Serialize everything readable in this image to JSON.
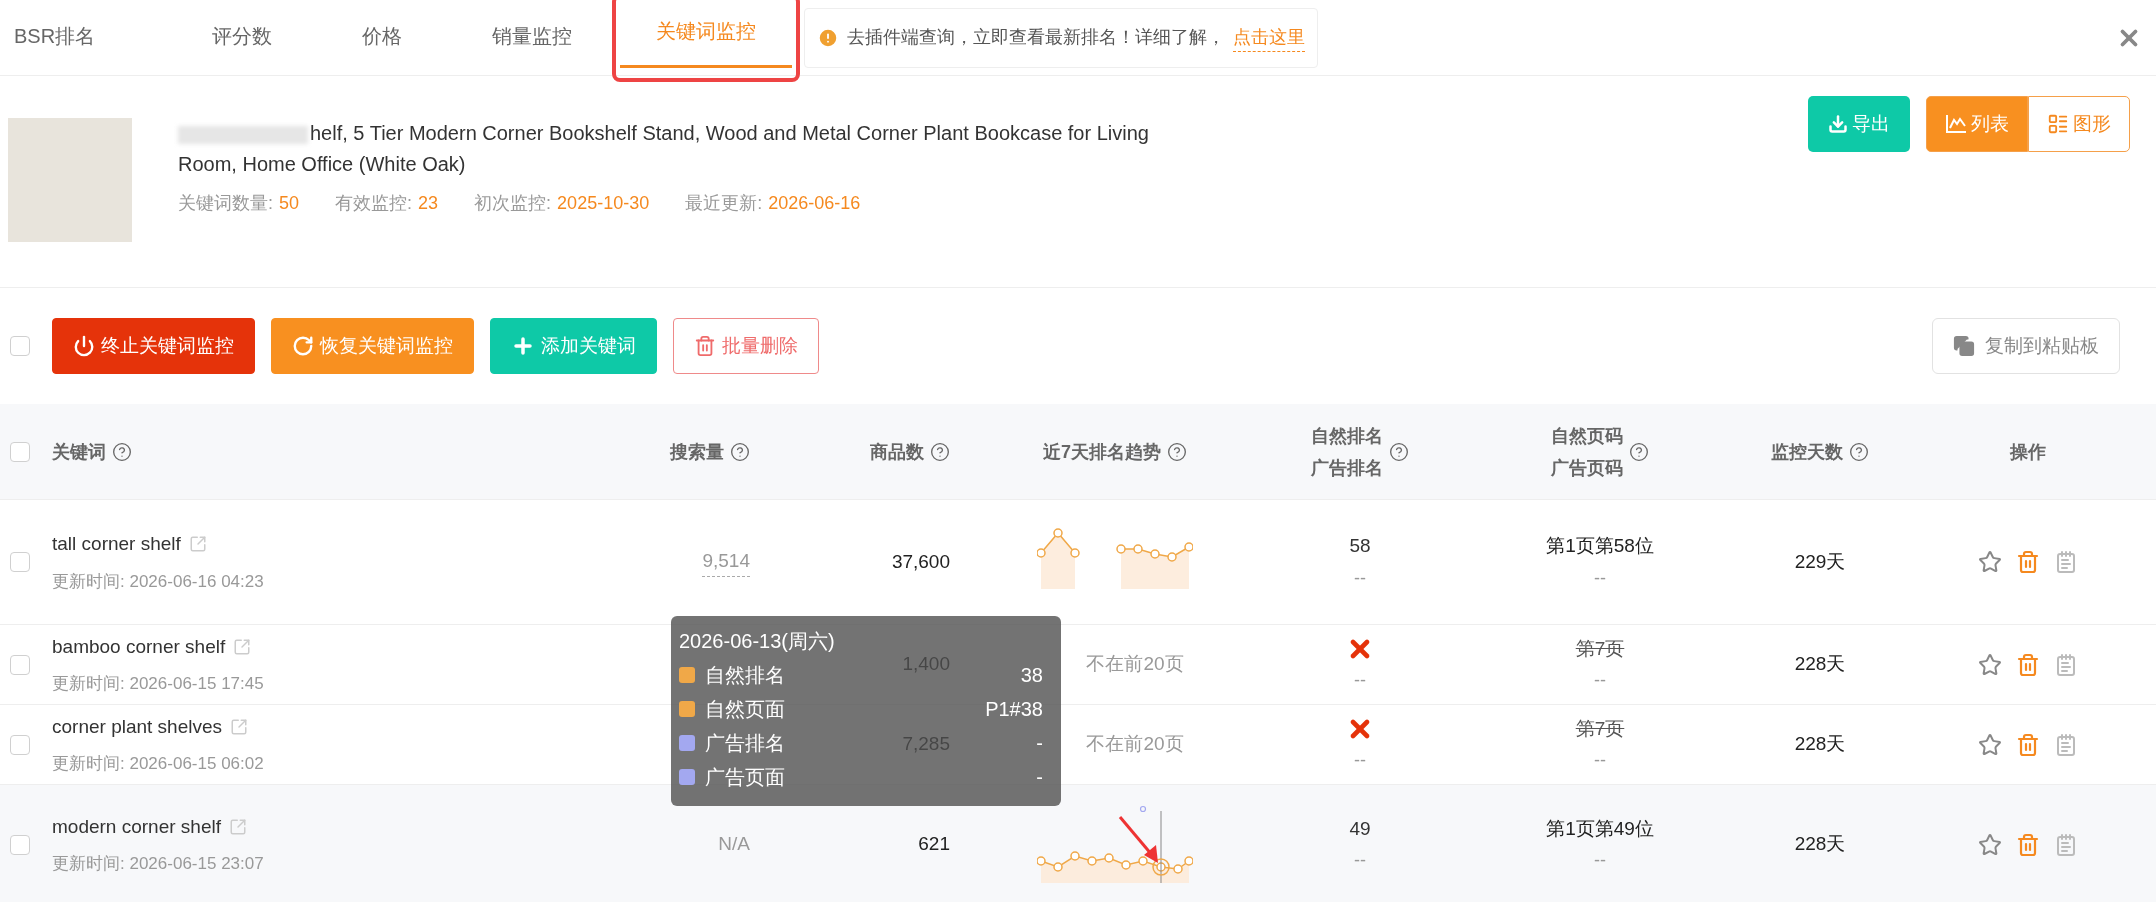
{
  "tabs": [
    {
      "label": "BSR排名",
      "selected": false
    },
    {
      "label": "评分数",
      "selected": false
    },
    {
      "label": "价格",
      "selected": false
    },
    {
      "label": "销量监控",
      "selected": false
    },
    {
      "label": "关键词监控",
      "selected": true
    }
  ],
  "notice": {
    "text": "去插件端查询，立即查看最新排名！详细了解，",
    "link": "点击这里"
  },
  "product": {
    "title": "helf, 5 Tier Modern Corner Bookshelf Stand, Wood and Metal Corner Plant Bookcase for Living Room, Home Office (White Oak)",
    "stats": [
      {
        "label": "关键词数量:",
        "value": "50"
      },
      {
        "label": "有效监控:",
        "value": "23"
      },
      {
        "label": "初次监控:",
        "value": "2025-10-30"
      },
      {
        "label": "最近更新:",
        "value": "2026-06-16"
      }
    ]
  },
  "export_button": "导出",
  "view_toggle": [
    {
      "label": "列表",
      "kind": "chart",
      "selected": true
    },
    {
      "label": "图形",
      "kind": "grid",
      "selected": false
    }
  ],
  "toolbar": {
    "select_all_checked": false,
    "buttons": [
      {
        "label": "终止关键词监控",
        "kind": "stop"
      },
      {
        "label": "恢复关键词监控",
        "kind": "resume"
      },
      {
        "label": "添加关键词",
        "kind": "add"
      },
      {
        "label": "批量删除",
        "kind": "delete"
      }
    ],
    "copy_button": "复制到粘贴板"
  },
  "table": {
    "header_checked": false,
    "columns": [
      {
        "label": "关键词",
        "help": true
      },
      {
        "label": "搜索量",
        "help": true
      },
      {
        "label": "商品数",
        "help": true
      },
      {
        "label": "近7天排名趋势",
        "help": true
      },
      {
        "label": "自然排名",
        "label2": "广告排名",
        "help": true
      },
      {
        "label": "自然页码",
        "label2": "广告页码",
        "help": true
      },
      {
        "label": "监控天数",
        "help": true
      },
      {
        "label": "操作",
        "help": false
      }
    ],
    "rows": [
      {
        "checked": false,
        "highlighted": false,
        "keyword": "tall corner shelf",
        "updated": "更新时间: 2026-06-16 04:23",
        "search_volume": "9,514",
        "search_underlined": true,
        "products": "37,600",
        "trend": {
          "kind": "sparkline"
        },
        "organic_rank": {
          "kind": "value",
          "text": "58"
        },
        "ad_rank": "--",
        "organic_page": "第1页第58位",
        "organic_page_struck": false,
        "ad_page": "--",
        "days": "229天"
      },
      {
        "checked": false,
        "highlighted": false,
        "keyword": "bamboo corner shelf",
        "updated": "更新时间: 2026-06-15 17:45",
        "products": "1,400",
        "trend": {
          "kind": "text",
          "text": "不在前20页"
        },
        "organic_rank": {
          "kind": "missing"
        },
        "ad_rank": "--",
        "organic_page": "第7页",
        "organic_page_struck": true,
        "ad_page": "--",
        "days": "228天"
      },
      {
        "checked": false,
        "highlighted": false,
        "keyword": "corner plant shelves",
        "updated": "更新时间: 2026-06-15 06:02",
        "products": "7,285",
        "trend": {
          "kind": "text",
          "text": "不在前20页"
        },
        "organic_rank": {
          "kind": "missing"
        },
        "ad_rank": "--",
        "organic_page": "第7页",
        "organic_page_struck": true,
        "ad_page": "--",
        "days": "228天"
      },
      {
        "checked": false,
        "highlighted": true,
        "keyword": "modern corner shelf",
        "updated": "更新时间: 2026-06-15 23:07",
        "search_volume": "N/A",
        "search_underlined": false,
        "products": "621",
        "trend": {
          "kind": "sparkline"
        },
        "organic_rank": {
          "kind": "value",
          "text": "49"
        },
        "ad_rank": "--",
        "organic_page": "第1页第49位",
        "organic_page_struck": false,
        "ad_page": "--",
        "days": "228天"
      }
    ]
  },
  "tooltip": {
    "title": "2026-06-13(周六)",
    "items": [
      {
        "label": "自然排名",
        "value": "38",
        "color": "#f0a848"
      },
      {
        "label": "自然页面",
        "value": "P1#38",
        "color": "#f0a848"
      },
      {
        "label": "广告排名",
        "value": "-",
        "color": "#a3a8f0"
      },
      {
        "label": "广告页面",
        "value": "-",
        "color": "#a3a8f0"
      }
    ]
  }
}
